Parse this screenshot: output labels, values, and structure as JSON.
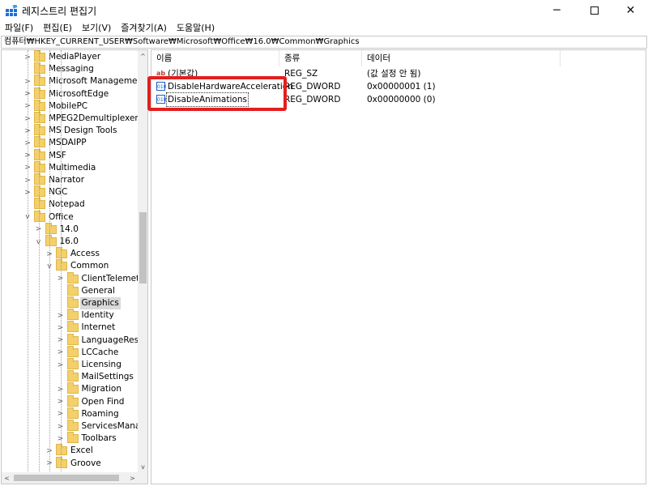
{
  "window": {
    "title": "레지스트리 편집기",
    "icon": "registry-editor-icon",
    "controls": {
      "minimize": "─",
      "close": "✕"
    }
  },
  "menu": [
    "파일(F)",
    "편집(E)",
    "보기(V)",
    "즐겨찾기(A)",
    "도움말(H)"
  ],
  "address": "컴퓨터₩HKEY_CURRENT_USER₩Software₩Microsoft₩Office₩16.0₩Common₩Graphics",
  "tree": {
    "items": [
      {
        "label": "MediaPlayer",
        "expander": ">",
        "depth": 0
      },
      {
        "label": "Messaging",
        "expander": "",
        "depth": 0
      },
      {
        "label": "Microsoft Management",
        "expander": ">",
        "depth": 0
      },
      {
        "label": "MicrosoftEdge",
        "expander": ">",
        "depth": 0
      },
      {
        "label": "MobilePC",
        "expander": ">",
        "depth": 0
      },
      {
        "label": "MPEG2Demultiplexer",
        "expander": ">",
        "depth": 0
      },
      {
        "label": "MS Design Tools",
        "expander": ">",
        "depth": 0
      },
      {
        "label": "MSDAIPP",
        "expander": ">",
        "depth": 0
      },
      {
        "label": "MSF",
        "expander": ">",
        "depth": 0
      },
      {
        "label": "Multimedia",
        "expander": ">",
        "depth": 0
      },
      {
        "label": "Narrator",
        "expander": ">",
        "depth": 0
      },
      {
        "label": "NGC",
        "expander": ">",
        "depth": 0
      },
      {
        "label": "Notepad",
        "expander": "",
        "depth": 0
      },
      {
        "label": "Office",
        "expander": "v",
        "depth": 0
      },
      {
        "label": "14.0",
        "expander": ">",
        "depth": 1
      },
      {
        "label": "16.0",
        "expander": "v",
        "depth": 1
      },
      {
        "label": "Access",
        "expander": ">",
        "depth": 2
      },
      {
        "label": "Common",
        "expander": "v",
        "depth": 2
      },
      {
        "label": "ClientTelemetry",
        "expander": ">",
        "depth": 3
      },
      {
        "label": "General",
        "expander": "",
        "depth": 3
      },
      {
        "label": "Graphics",
        "expander": "",
        "depth": 3,
        "selected": true
      },
      {
        "label": "Identity",
        "expander": ">",
        "depth": 3
      },
      {
        "label": "Internet",
        "expander": ">",
        "depth": 3
      },
      {
        "label": "LanguageResou",
        "expander": ">",
        "depth": 3
      },
      {
        "label": "LCCache",
        "expander": ">",
        "depth": 3
      },
      {
        "label": "Licensing",
        "expander": ">",
        "depth": 3
      },
      {
        "label": "MailSettings",
        "expander": "",
        "depth": 3
      },
      {
        "label": "Migration",
        "expander": ">",
        "depth": 3
      },
      {
        "label": "Open Find",
        "expander": ">",
        "depth": 3
      },
      {
        "label": "Roaming",
        "expander": ">",
        "depth": 3
      },
      {
        "label": "ServicesManage",
        "expander": ">",
        "depth": 3
      },
      {
        "label": "Toolbars",
        "expander": ">",
        "depth": 3
      },
      {
        "label": "Excel",
        "expander": ">",
        "depth": 2
      },
      {
        "label": "Groove",
        "expander": ">",
        "depth": 2
      }
    ],
    "scroll_arrows": {
      "up": "^",
      "down": "v",
      "left": "<",
      "right": ">"
    }
  },
  "list": {
    "columns": [
      "이름",
      "종류",
      "데이터"
    ],
    "rows": [
      {
        "name": "(기본값)",
        "type": "REG_SZ",
        "data": "(값 설정 안 됨)",
        "icon": "string-value-icon",
        "icon_text": "ab"
      },
      {
        "name": "DisableHardwareAcceleration",
        "type": "REG_DWORD",
        "data": "0x00000001 (1)",
        "icon": "dword-value-icon",
        "icon_text": "010"
      },
      {
        "name": "DisableAnimations",
        "type": "REG_DWORD",
        "data": "0x00000000 (0)",
        "icon": "dword-value-icon",
        "icon_text": "010",
        "focused": true
      }
    ]
  },
  "colors": {
    "highlight": "#e21f1f",
    "folder": "#f4d06b",
    "selection": "#d9d9d9"
  }
}
